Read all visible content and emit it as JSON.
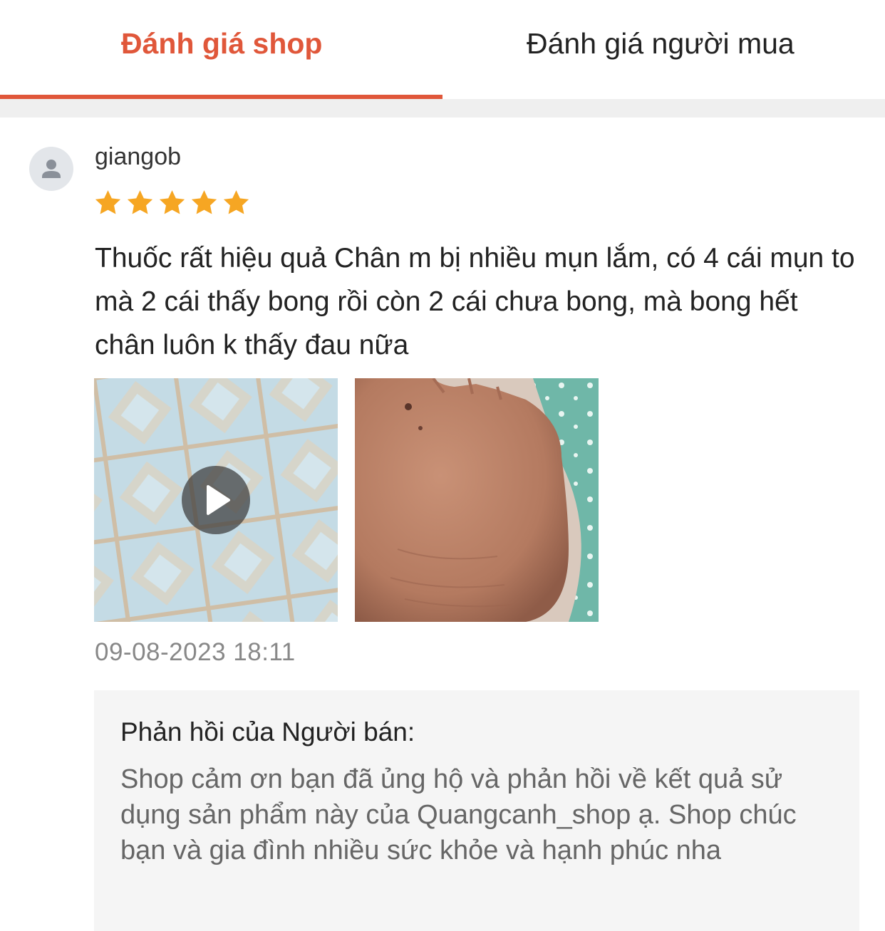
{
  "tabs": {
    "shop_reviews": "Đánh giá shop",
    "buyer_reviews": "Đánh giá người mua",
    "active": "shop_reviews",
    "accent_color": "#e0573a"
  },
  "review": {
    "username": "giangob",
    "rating": 5,
    "max_rating": 5,
    "star_color": "#f6a623",
    "text": "Thuốc rất hiệu quả  Chân m bị nhiều mụn lắm, có 4 cái mụn to mà 2 cái thấy bong rồi còn 2 cái chưa bong, mà bong hết chân luôn k thấy đau nữa",
    "media": [
      {
        "kind": "video",
        "icon": "play-icon"
      },
      {
        "kind": "image"
      }
    ],
    "timestamp": "09-08-2023 18:11"
  },
  "seller_reply": {
    "title": "Phản hồi của Người bán:",
    "text": "Shop cảm ơn bạn đã ủng hộ và phản hồi về kết quả sử dụng sản phẩm này của Quangcanh_shop ạ. Shop chúc bạn và gia đình nhiều sức khỏe và hạnh phúc nha"
  }
}
